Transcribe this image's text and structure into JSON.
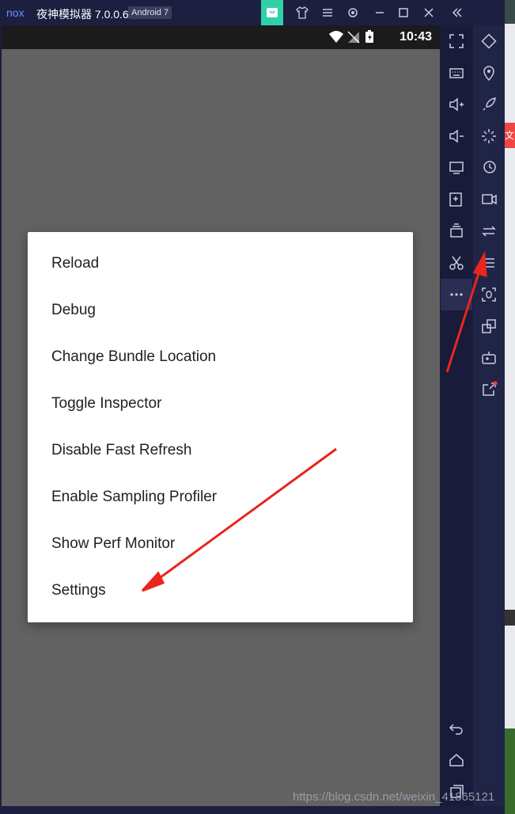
{
  "window": {
    "title": "夜神模拟器 7.0.0.6",
    "android_badge": "Android 7",
    "accent_color": "#2fd0a8"
  },
  "statusbar": {
    "time": "10:43"
  },
  "dev_menu": {
    "items": [
      "Reload",
      "Debug",
      "Change Bundle Location",
      "Toggle Inspector",
      "Disable Fast Refresh",
      "Enable Sampling Profiler",
      "Show Perf Monitor",
      "Settings"
    ]
  },
  "background": {
    "red_tab_char": "文"
  },
  "watermark": "https://blog.csdn.net/weixin_41865121",
  "annotation_color": "#e8261c"
}
